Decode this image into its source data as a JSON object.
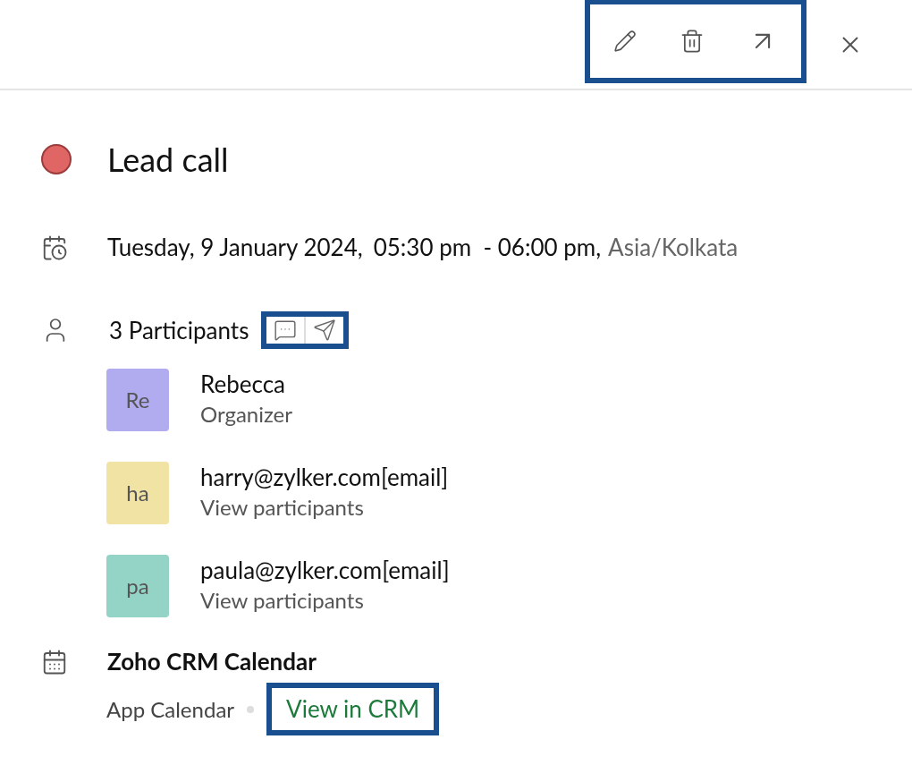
{
  "toolbar": {
    "highlighted": true
  },
  "event": {
    "title": "Lead call",
    "color": "#e06666"
  },
  "datetime": {
    "date": "Tuesday, 9 January 2024,",
    "time": "05:30 pm  - 06:00 pm,",
    "timezone": "Asia/Kolkata"
  },
  "participants": {
    "count": "3 Participants",
    "actions_highlighted": true,
    "list": [
      {
        "initials": "Re",
        "name": "Rebecca",
        "role": "Organizer",
        "color": "#b1abef"
      },
      {
        "initials": "ha",
        "name": "harry@zylker.com[email]",
        "role": "View participants",
        "color": "#f1e3a4"
      },
      {
        "initials": "pa",
        "name": "paula@zylker.com[email]",
        "role": "View participants",
        "color": "#93d4c7"
      }
    ]
  },
  "calendar": {
    "name": "Zoho CRM Calendar",
    "type": "App Calendar",
    "link": "View in CRM",
    "link_highlighted": true
  }
}
